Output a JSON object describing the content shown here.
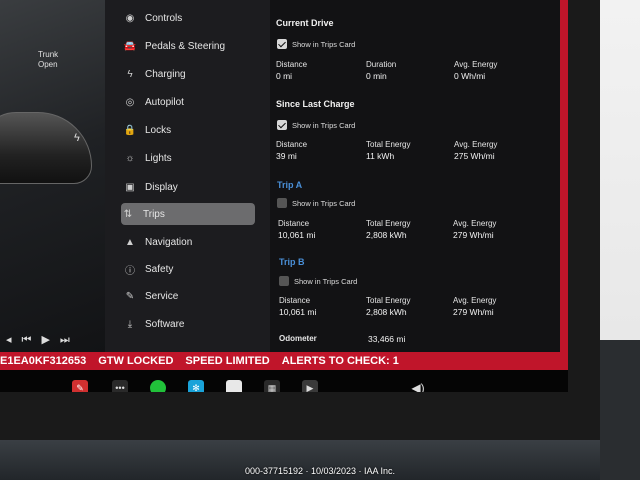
{
  "car": {
    "trunk_label": "Trunk",
    "trunk_state": "Open"
  },
  "sidebar": {
    "items": [
      {
        "label": "Controls",
        "icon": "toggle-icon",
        "glyph": "◉"
      },
      {
        "label": "Pedals & Steering",
        "icon": "car-icon",
        "glyph": "🚘"
      },
      {
        "label": "Charging",
        "icon": "bolt-icon",
        "glyph": "ϟ"
      },
      {
        "label": "Autopilot",
        "icon": "steering-wheel-icon",
        "glyph": "◎"
      },
      {
        "label": "Locks",
        "icon": "lock-icon",
        "glyph": "🔒"
      },
      {
        "label": "Lights",
        "icon": "sun-icon",
        "glyph": "☼"
      },
      {
        "label": "Display",
        "icon": "display-icon",
        "glyph": "▣"
      },
      {
        "label": "Trips",
        "icon": "trips-icon",
        "glyph": "⇅"
      },
      {
        "label": "Navigation",
        "icon": "navigation-arrow-icon",
        "glyph": "▲"
      },
      {
        "label": "Safety",
        "icon": "safety-icon",
        "glyph": "ⓘ"
      },
      {
        "label": "Service",
        "icon": "wrench-icon",
        "glyph": "✎"
      },
      {
        "label": "Software",
        "icon": "download-icon",
        "glyph": "⤓"
      }
    ],
    "active_index": 7
  },
  "trips": {
    "current_drive": {
      "title": "Current Drive",
      "show_label": "Show in Trips Card",
      "checked": true,
      "distance_label": "Distance",
      "distance": "0 mi",
      "duration_label": "Duration",
      "duration": "0 min",
      "energy_label": "Avg. Energy",
      "energy": "0 Wh/mi"
    },
    "since_charge": {
      "title": "Since Last Charge",
      "show_label": "Show in Trips Card",
      "checked": true,
      "distance_label": "Distance",
      "distance": "39 mi",
      "total_label": "Total Energy",
      "total": "11 kWh",
      "energy_label": "Avg. Energy",
      "energy": "275 Wh/mi"
    },
    "trip_a": {
      "title": "Trip A",
      "show_label": "Show in Trips Card",
      "checked": false,
      "distance_label": "Distance",
      "distance": "10,061 mi",
      "total_label": "Total Energy",
      "total": "2,808 kWh",
      "energy_label": "Avg. Energy",
      "energy": "279 Wh/mi"
    },
    "trip_b": {
      "title": "Trip B",
      "show_label": "Show in Trips Card",
      "checked": false,
      "distance_label": "Distance",
      "distance": "10,061 mi",
      "total_label": "Total Energy",
      "total": "2,808 kWh",
      "energy_label": "Avg. Energy",
      "energy": "279 Wh/mi"
    },
    "odometer_label": "Odometer",
    "odometer": "33,466 mi"
  },
  "status": {
    "vin": "E1EA0KF312653",
    "gtw": "GTW LOCKED",
    "speed": "SPEED LIMITED",
    "alerts": "ALERTS TO CHECK: 1",
    "color": "#c0152a"
  },
  "dock": {
    "icons": [
      "wrench-icon",
      "more-icon",
      "green-dot-icon",
      "fan-icon",
      "card-icon",
      "calendar-icon",
      "media-icon",
      "volume-icon"
    ]
  },
  "watermark": "000-37715192 · 10/03/2023 · IAA Inc."
}
